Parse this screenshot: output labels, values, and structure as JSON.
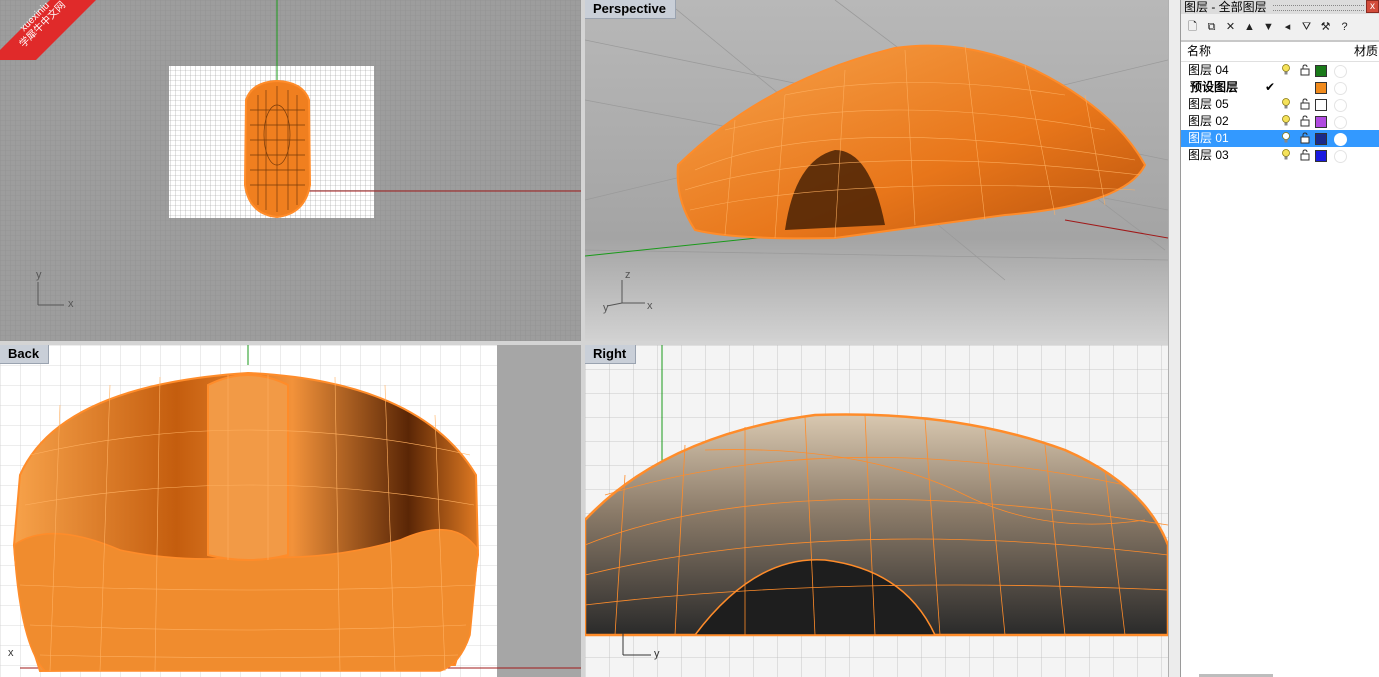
{
  "viewports": {
    "top": {
      "label": "",
      "axis_x": "x",
      "axis_y": "y"
    },
    "perspective": {
      "label": "Perspective",
      "axis_x": "x",
      "axis_y": "y",
      "axis_z": "z"
    },
    "back": {
      "label": "Back",
      "axis_x": "x"
    },
    "right": {
      "label": "Right",
      "axis_y": "y"
    }
  },
  "watermark": {
    "line1": "xuexiniu",
    "line2": "学犀牛中文网"
  },
  "layer_panel": {
    "title": "图层 - 全部图层",
    "close": "x",
    "toolbar": [
      {
        "name": "new-layer-icon",
        "glyph": "🗋"
      },
      {
        "name": "new-sublayer-icon",
        "glyph": "⧉"
      },
      {
        "name": "delete-icon",
        "glyph": "✕"
      },
      {
        "name": "move-up-icon",
        "glyph": "▲"
      },
      {
        "name": "move-down-icon",
        "glyph": "▼"
      },
      {
        "name": "move-left-icon",
        "glyph": "◂"
      },
      {
        "name": "filter-icon",
        "glyph": "⛛"
      },
      {
        "name": "tools-icon",
        "glyph": "⚒"
      },
      {
        "name": "help-icon",
        "glyph": "?"
      }
    ],
    "columns": {
      "name": "名称",
      "material": "材质"
    },
    "layers": [
      {
        "name": "图层 04",
        "color": "#1a7a1a",
        "current": false,
        "selected": false,
        "bold": false
      },
      {
        "name": "预设图层",
        "color": "#f08a1c",
        "current": true,
        "selected": false,
        "bold": true
      },
      {
        "name": "图层 05",
        "color": "#ffffff",
        "current": false,
        "selected": false,
        "bold": false
      },
      {
        "name": "图层 02",
        "color": "#b04ae0",
        "current": false,
        "selected": false,
        "bold": false
      },
      {
        "name": "图层 01",
        "color": "#1a2a8a",
        "current": false,
        "selected": true,
        "bold": false
      },
      {
        "name": "图层 03",
        "color": "#1a1ae0",
        "current": false,
        "selected": false,
        "bold": false
      }
    ],
    "current_mark": "✔"
  },
  "colors": {
    "shell": "#f07f1f",
    "wire": "#ff9a3a",
    "selected_row": "#3399ff"
  }
}
